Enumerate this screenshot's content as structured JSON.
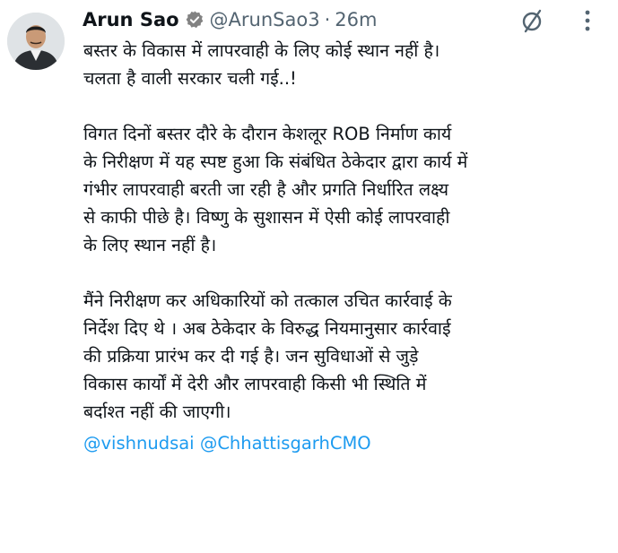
{
  "author": {
    "name": "Arun Sao",
    "handle": "@ArunSao3",
    "separator": "·",
    "time": "26m"
  },
  "icons": {
    "verified": "verified-badge-icon",
    "grok": "grok-icon",
    "more": "more-options-icon"
  },
  "colors": {
    "accent": "#1d9bf0",
    "muted": "#536471",
    "text": "#0f1419"
  },
  "tweet": {
    "lines1": [
      "बस्तर के विकास में लापरवाही के लिए कोई स्थान नहीं है।",
      "चलता है वाली सरकार चली गई..!"
    ],
    "lines2": [
      "विगत दिनों बस्तर दौरे के दौरान केशलूर ROB निर्माण कार्य",
      "के निरीक्षण में यह स्पष्ट हुआ कि संबंधित ठेकेदार द्वारा कार्य में",
      "गंभीर लापरवाही बरती जा रही है और प्रगति निर्धारित लक्ष्य",
      "से काफी पीछे है। विष्णु के सुशासन में ऐसी कोई लापरवाही",
      "के लिए स्थान नहीं है।"
    ],
    "lines3": [
      "मैंने निरीक्षण कर अधिकारियों को तत्काल उचित कार्रवाई के",
      "निर्देश दिए थे । अब ठेकेदार के विरुद्ध नियमानुसार कार्रवाई",
      "की प्रक्रिया प्रारंभ कर दी गई है। जन सुविधाओं से जुड़े",
      "विकास कार्यों में देरी और लापरवाही किसी भी स्थिति में",
      "बर्दाश्त नहीं की जाएगी।"
    ],
    "mentions": [
      "@vishnudsai",
      "@ChhattisgarhCMO"
    ]
  }
}
